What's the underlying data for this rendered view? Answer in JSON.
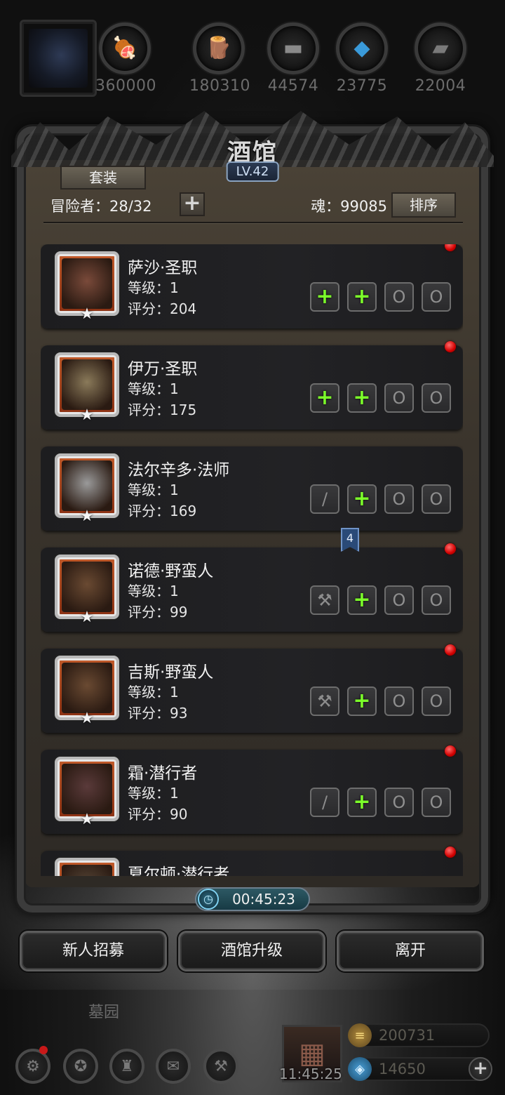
{
  "resources": [
    {
      "icon": "meat-icon",
      "glyph": "🍖",
      "value": "360000",
      "color": "#8a3a1e"
    },
    {
      "icon": "wood-icon",
      "glyph": "🪵",
      "value": "180310",
      "color": "#8a5a2a"
    },
    {
      "icon": "iron-ingot-icon",
      "glyph": "▬",
      "value": "44574",
      "color": "#777777"
    },
    {
      "icon": "crystal-icon",
      "glyph": "◆",
      "value": "23775",
      "color": "#3a9ad9"
    },
    {
      "icon": "steel-icon",
      "glyph": "▰",
      "value": "22004",
      "color": "#666666"
    }
  ],
  "tavern": {
    "title": "酒馆",
    "level": "LV.42",
    "suit_button": "套装",
    "adventurers": "冒险者：28/32",
    "add_button": "+",
    "soul": "魂：99085",
    "sort_button": "排序"
  },
  "heroes": [
    {
      "name": "萨沙·圣职",
      "level": "等级：1",
      "score": "评分：204",
      "face": "#7a4a3a",
      "red_dot": true,
      "slots": [
        {
          "type": "plus",
          "glyph": "+"
        },
        {
          "type": "plus",
          "glyph": "+"
        },
        {
          "type": "ring",
          "glyph": "O"
        },
        {
          "type": "ring",
          "glyph": "O"
        }
      ]
    },
    {
      "name": "伊万·圣职",
      "level": "等级：1",
      "score": "评分：175",
      "face": "#8a7a5a",
      "red_dot": true,
      "slots": [
        {
          "type": "plus",
          "glyph": "+"
        },
        {
          "type": "plus",
          "glyph": "+"
        },
        {
          "type": "ring",
          "glyph": "O"
        },
        {
          "type": "ring",
          "glyph": "O"
        }
      ]
    },
    {
      "name": "法尔辛多·法师",
      "level": "等级：1",
      "score": "评分：169",
      "face": "#9a9a9a",
      "red_dot": false,
      "slots": [
        {
          "type": "weapon",
          "glyph": "/"
        },
        {
          "type": "plus",
          "glyph": "+"
        },
        {
          "type": "ring",
          "glyph": "O"
        },
        {
          "type": "ring",
          "glyph": "O"
        }
      ]
    },
    {
      "name": "诺德·野蛮人",
      "level": "等级：1",
      "score": "评分：99",
      "face": "#6a4a32",
      "red_dot": true,
      "slots": [
        {
          "type": "weapon",
          "glyph": "⚒"
        },
        {
          "type": "plus",
          "glyph": "+"
        },
        {
          "type": "ring",
          "glyph": "O"
        },
        {
          "type": "ring",
          "glyph": "O"
        }
      ]
    },
    {
      "name": "吉斯·野蛮人",
      "level": "等级：1",
      "score": "评分：93",
      "face": "#6a4a32",
      "red_dot": true,
      "slots": [
        {
          "type": "weapon",
          "glyph": "⚒"
        },
        {
          "type": "plus",
          "glyph": "+"
        },
        {
          "type": "ring",
          "glyph": "O"
        },
        {
          "type": "ring",
          "glyph": "O"
        }
      ]
    },
    {
      "name": "霜·潜行者",
      "level": "等级：1",
      "score": "评分：90",
      "face": "#5a3a3a",
      "red_dot": true,
      "slots": [
        {
          "type": "weapon",
          "glyph": "/"
        },
        {
          "type": "plus",
          "glyph": "+"
        },
        {
          "type": "ring",
          "glyph": "O"
        },
        {
          "type": "ring",
          "glyph": "O"
        }
      ]
    },
    {
      "name": "夏尔顿·潜行者",
      "level": "",
      "score": "",
      "face": "#5a4a3a",
      "red_dot": true,
      "slots": []
    }
  ],
  "marker_number": "4",
  "timer": "00:45:23",
  "actions": {
    "recruit": "新人招募",
    "upgrade": "酒馆升级",
    "leave": "离开"
  },
  "hud": {
    "area_name": "墓园",
    "gift_timer": "11:45:25",
    "gold": "200731",
    "gems": "14650",
    "nav_icons": [
      "settings-icon",
      "hero-icon",
      "guild-icon",
      "mail-icon",
      "craft-icon"
    ]
  },
  "colors": {
    "accent_green": "#7cff2a",
    "notify_red": "#d10000",
    "panel_bg": "#3a342c"
  }
}
